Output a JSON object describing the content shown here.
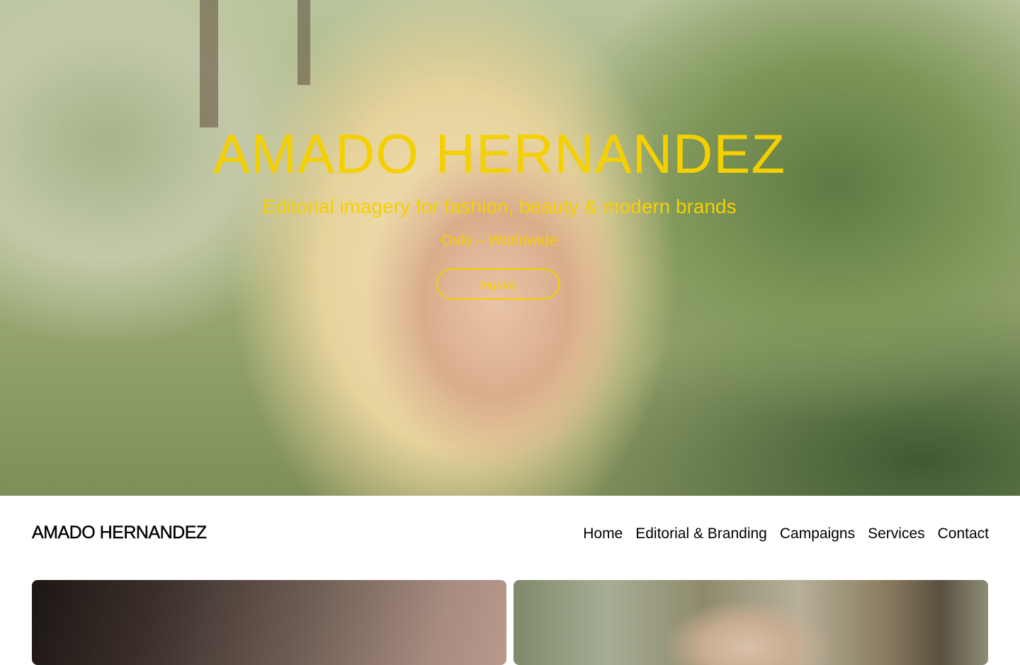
{
  "hero": {
    "title": "AMADO HERNANDEZ",
    "subtitle": "Editorial imagery for fashion, beauty & modern brands",
    "location": "Oslo – Worldwide",
    "cta_label": "Inquire",
    "accent_color": "#f5d000"
  },
  "header": {
    "brand": "AMADO HERNANDEZ",
    "nav": [
      {
        "label": "Home"
      },
      {
        "label": "Editorial & Branding"
      },
      {
        "label": "Campaigns"
      },
      {
        "label": "Services"
      },
      {
        "label": "Contact"
      }
    ]
  }
}
